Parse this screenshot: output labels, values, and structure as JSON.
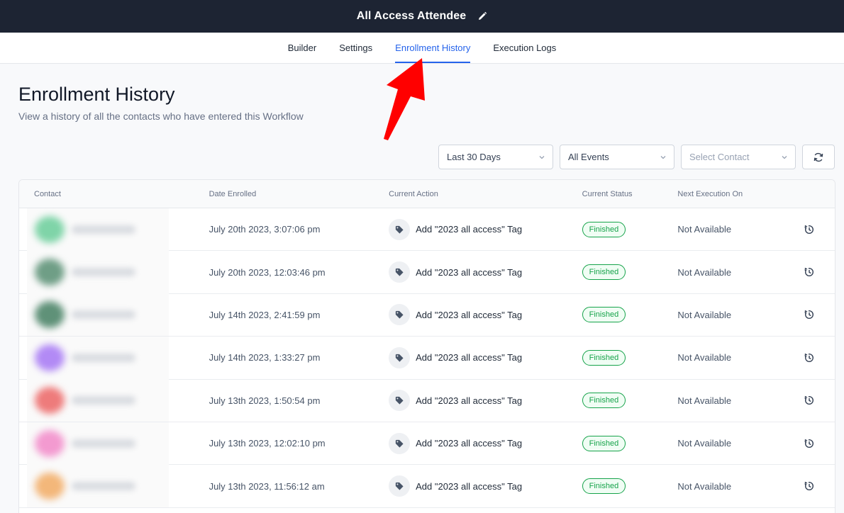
{
  "header": {
    "title": "All Access Attendee",
    "edit_icon": "pencil-icon"
  },
  "tabs": [
    {
      "label": "Builder",
      "active": false
    },
    {
      "label": "Settings",
      "active": false
    },
    {
      "label": "Enrollment History",
      "active": true
    },
    {
      "label": "Execution Logs",
      "active": false
    }
  ],
  "page": {
    "title": "Enrollment History",
    "subtitle": "View a history of all the contacts who have entered this Workflow"
  },
  "filters": {
    "date": "Last 30 Days",
    "events": "All Events",
    "contact_placeholder": "Select Contact"
  },
  "table": {
    "columns": [
      "Contact",
      "Date Enrolled",
      "Current Action",
      "Current Status",
      "Next Execution On"
    ],
    "rows": [
      {
        "avatar_color": "#7fd4a8",
        "date": "July 20th 2023, 3:07:06 pm",
        "action": "Add \"2023 all access\" Tag",
        "status": "Finished",
        "next": "Not Available"
      },
      {
        "avatar_color": "#6f9e86",
        "date": "July 20th 2023, 12:03:46 pm",
        "action": "Add \"2023 all access\" Tag",
        "status": "Finished",
        "next": "Not Available"
      },
      {
        "avatar_color": "#5f9178",
        "date": "July 14th 2023, 2:41:59 pm",
        "action": "Add \"2023 all access\" Tag",
        "status": "Finished",
        "next": "Not Available"
      },
      {
        "avatar_color": "#b28af5",
        "date": "July 14th 2023, 1:33:27 pm",
        "action": "Add \"2023 all access\" Tag",
        "status": "Finished",
        "next": "Not Available"
      },
      {
        "avatar_color": "#ee7b7b",
        "date": "July 13th 2023, 1:50:54 pm",
        "action": "Add \"2023 all access\" Tag",
        "status": "Finished",
        "next": "Not Available"
      },
      {
        "avatar_color": "#f39ad0",
        "date": "July 13th 2023, 12:02:10 pm",
        "action": "Add \"2023 all access\" Tag",
        "status": "Finished",
        "next": "Not Available"
      },
      {
        "avatar_color": "#f3b77a",
        "date": "July 13th 2023, 11:56:12 am",
        "action": "Add \"2023 all access\" Tag",
        "status": "Finished",
        "next": "Not Available"
      }
    ]
  },
  "colors": {
    "accent": "#2563eb",
    "success": "#16a34a",
    "topbar": "#1d2433",
    "annotation_arrow": "#ff0000"
  }
}
